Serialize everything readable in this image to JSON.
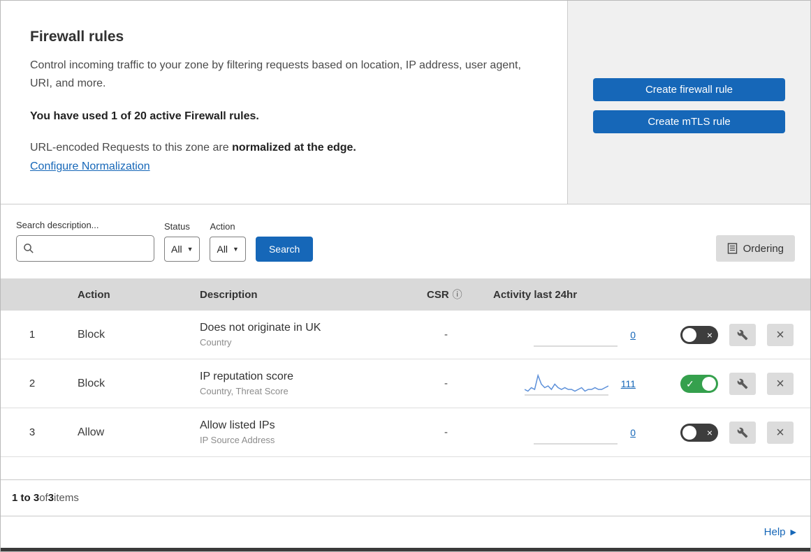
{
  "colors": {
    "accent-blue": "#1667b8",
    "link-blue": "#1667b8",
    "toggle-green": "#35a04d",
    "toggle-off": "#3d3d3d",
    "panel-gray": "#f0f0f0",
    "table-header-bg": "#d9d9d9",
    "btn-gray": "#dcdcdc",
    "sparkline-blue": "#5b8fd9"
  },
  "header": {
    "title": "Firewall rules",
    "description": "Control incoming traffic to your zone by filtering requests based on location, IP address, user agent, URI, and more.",
    "usage": "You have used 1 of 20 active Firewall rules.",
    "normalization_prefix": "URL-encoded Requests to this zone are ",
    "normalization_bold": "normalized at the edge.",
    "normalization_link": "Configure Normalization",
    "buttons": [
      {
        "label": "Create firewall rule"
      },
      {
        "label": "Create mTLS rule"
      }
    ]
  },
  "filters": {
    "search_label": "Search description...",
    "status_label": "Status",
    "status_value": "All",
    "action_label": "Action",
    "action_value": "All",
    "search_button_label": "Search",
    "ordering_button_label": "Ordering"
  },
  "table": {
    "headers": {
      "action": "Action",
      "description": "Description",
      "csr": "CSR",
      "activity": "Activity last 24hr"
    },
    "rows": [
      {
        "priority": "1",
        "action": "Block",
        "description": "Does not originate in UK",
        "fields": "Country",
        "csr": "-",
        "activity_count": "0",
        "enabled": false,
        "sparkline": []
      },
      {
        "priority": "2",
        "action": "Block",
        "description": "IP reputation score",
        "fields": "Country, Threat Score",
        "csr": "-",
        "activity_count": "111",
        "enabled": true,
        "sparkline": [
          2,
          1,
          3,
          2,
          10,
          5,
          3,
          4,
          2,
          5,
          3,
          2,
          3,
          2,
          2,
          1,
          2,
          3,
          1,
          2,
          2,
          3,
          2,
          2,
          3,
          4
        ]
      },
      {
        "priority": "3",
        "action": "Allow",
        "description": "Allow listed IPs",
        "fields": "IP Source Address",
        "csr": "-",
        "activity_count": "0",
        "enabled": false,
        "sparkline": []
      }
    ]
  },
  "footer": {
    "range": "1 to 3",
    "of_text": " of ",
    "total": "3",
    "items_text": " items"
  },
  "help": {
    "label": "Help"
  }
}
